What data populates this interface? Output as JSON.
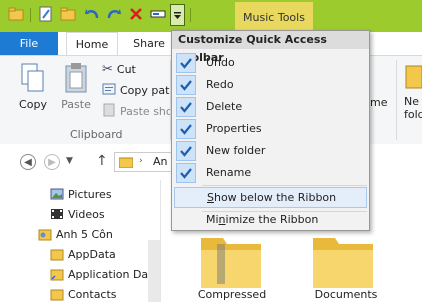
{
  "title_bar": {
    "contextual_tab": "Music Tools"
  },
  "tabs": [
    {
      "label": "File"
    },
    {
      "label": "Home"
    },
    {
      "label": "Share"
    }
  ],
  "ribbon": {
    "copy": "Copy",
    "paste": "Paste",
    "cut": "Cut",
    "copy_path": "Copy path",
    "paste_shortcut": "Paste sho",
    "group_label": "Clipboard",
    "rename_partial": "me",
    "new_folder_partial": "Ne",
    "new_folder_partial2": "fold"
  },
  "address": {
    "crumb": "An"
  },
  "nav": {
    "items": [
      {
        "label": "Pictures"
      },
      {
        "label": "Videos"
      },
      {
        "label": "Anh 5 Côn"
      },
      {
        "label": "AppData"
      },
      {
        "label": "Application Da"
      },
      {
        "label": "Contacts"
      }
    ]
  },
  "content": {
    "folders": [
      {
        "label": "Compressed"
      },
      {
        "label": "Documents"
      }
    ]
  },
  "qat_menu": {
    "header": "Customize Quick Access Toolbar",
    "items": [
      {
        "label": "Undo",
        "checked": true
      },
      {
        "label": "Redo",
        "checked": true
      },
      {
        "label": "Delete",
        "checked": true
      },
      {
        "label": "Properties",
        "checked": true
      },
      {
        "label": "New folder",
        "checked": true
      },
      {
        "label": "Rename",
        "checked": true
      }
    ],
    "show_below_pre": "",
    "show_below_u": "S",
    "show_below_post": "how below the Ribbon",
    "minimize_pre": "Mi",
    "minimize_u": "n",
    "minimize_post": "imize the Ribbon"
  },
  "colors": {
    "title_green": "#9ccb2e",
    "music_tools": "#e8d85e",
    "file_tab": "#1e7bd4",
    "check_blue": "#1a5fb4"
  }
}
